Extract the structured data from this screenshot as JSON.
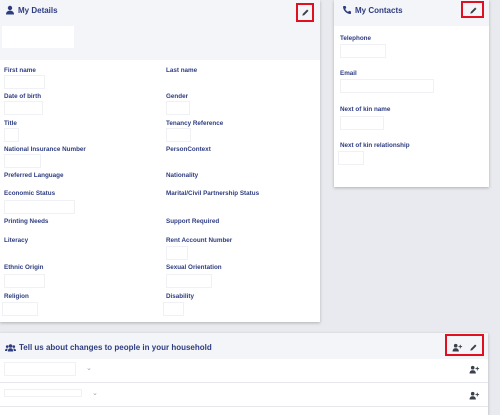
{
  "details": {
    "title": "My Details",
    "fields": {
      "first_name": {
        "label": "First name",
        "value": ""
      },
      "last_name": {
        "label": "Last name",
        "value": ""
      },
      "dob": {
        "label": "Date of birth",
        "value": ""
      },
      "gender": {
        "label": "Gender",
        "value": ""
      },
      "title_field": {
        "label": "Title",
        "value": ""
      },
      "tenancy_ref": {
        "label": "Tenancy Reference",
        "value": ""
      },
      "ni_number": {
        "label": "National Insurance Number",
        "value": ""
      },
      "person_context": {
        "label": "PersonContext",
        "value": ""
      },
      "pref_lang": {
        "label": "Preferred Language",
        "value": ""
      },
      "nationality": {
        "label": "Nationality",
        "value": ""
      },
      "economic_status": {
        "label": "Economic Status",
        "value": ""
      },
      "marital_status": {
        "label": "Marital/Civil Partnership Status",
        "value": ""
      },
      "printing_needs": {
        "label": "Printing Needs",
        "value": ""
      },
      "support_required": {
        "label": "Support Required",
        "value": ""
      },
      "literacy": {
        "label": "Literacy",
        "value": ""
      },
      "rent_account": {
        "label": "Rent Account Number",
        "value": ""
      },
      "ethnic_origin": {
        "label": "Ethnic Origin",
        "value": ""
      },
      "sexual_orientation": {
        "label": "Sexual Orientation",
        "value": ""
      },
      "religion": {
        "label": "Religion",
        "value": ""
      },
      "disability": {
        "label": "Disability",
        "value": ""
      }
    }
  },
  "contacts": {
    "title": "My Contacts",
    "fields": {
      "telephone": {
        "label": "Telephone",
        "value": ""
      },
      "email": {
        "label": "Email",
        "value": ""
      },
      "nok_name": {
        "label": "Next of kin name",
        "value": ""
      },
      "nok_relationship": {
        "label": "Next of kin relationship",
        "value": ""
      }
    }
  },
  "household": {
    "title": "Tell us about changes to people in your household",
    "rows": [
      {
        "name": ""
      },
      {
        "name": ""
      }
    ]
  },
  "icons": {
    "details": "user-icon",
    "contacts": "phone-icon",
    "household": "users-icon",
    "edit": "pencil-icon",
    "add_person": "add-person-icon",
    "dropdown": "chevron-down-icon"
  },
  "colors": {
    "primary": "#2e3d80",
    "highlight": "#e01020"
  }
}
